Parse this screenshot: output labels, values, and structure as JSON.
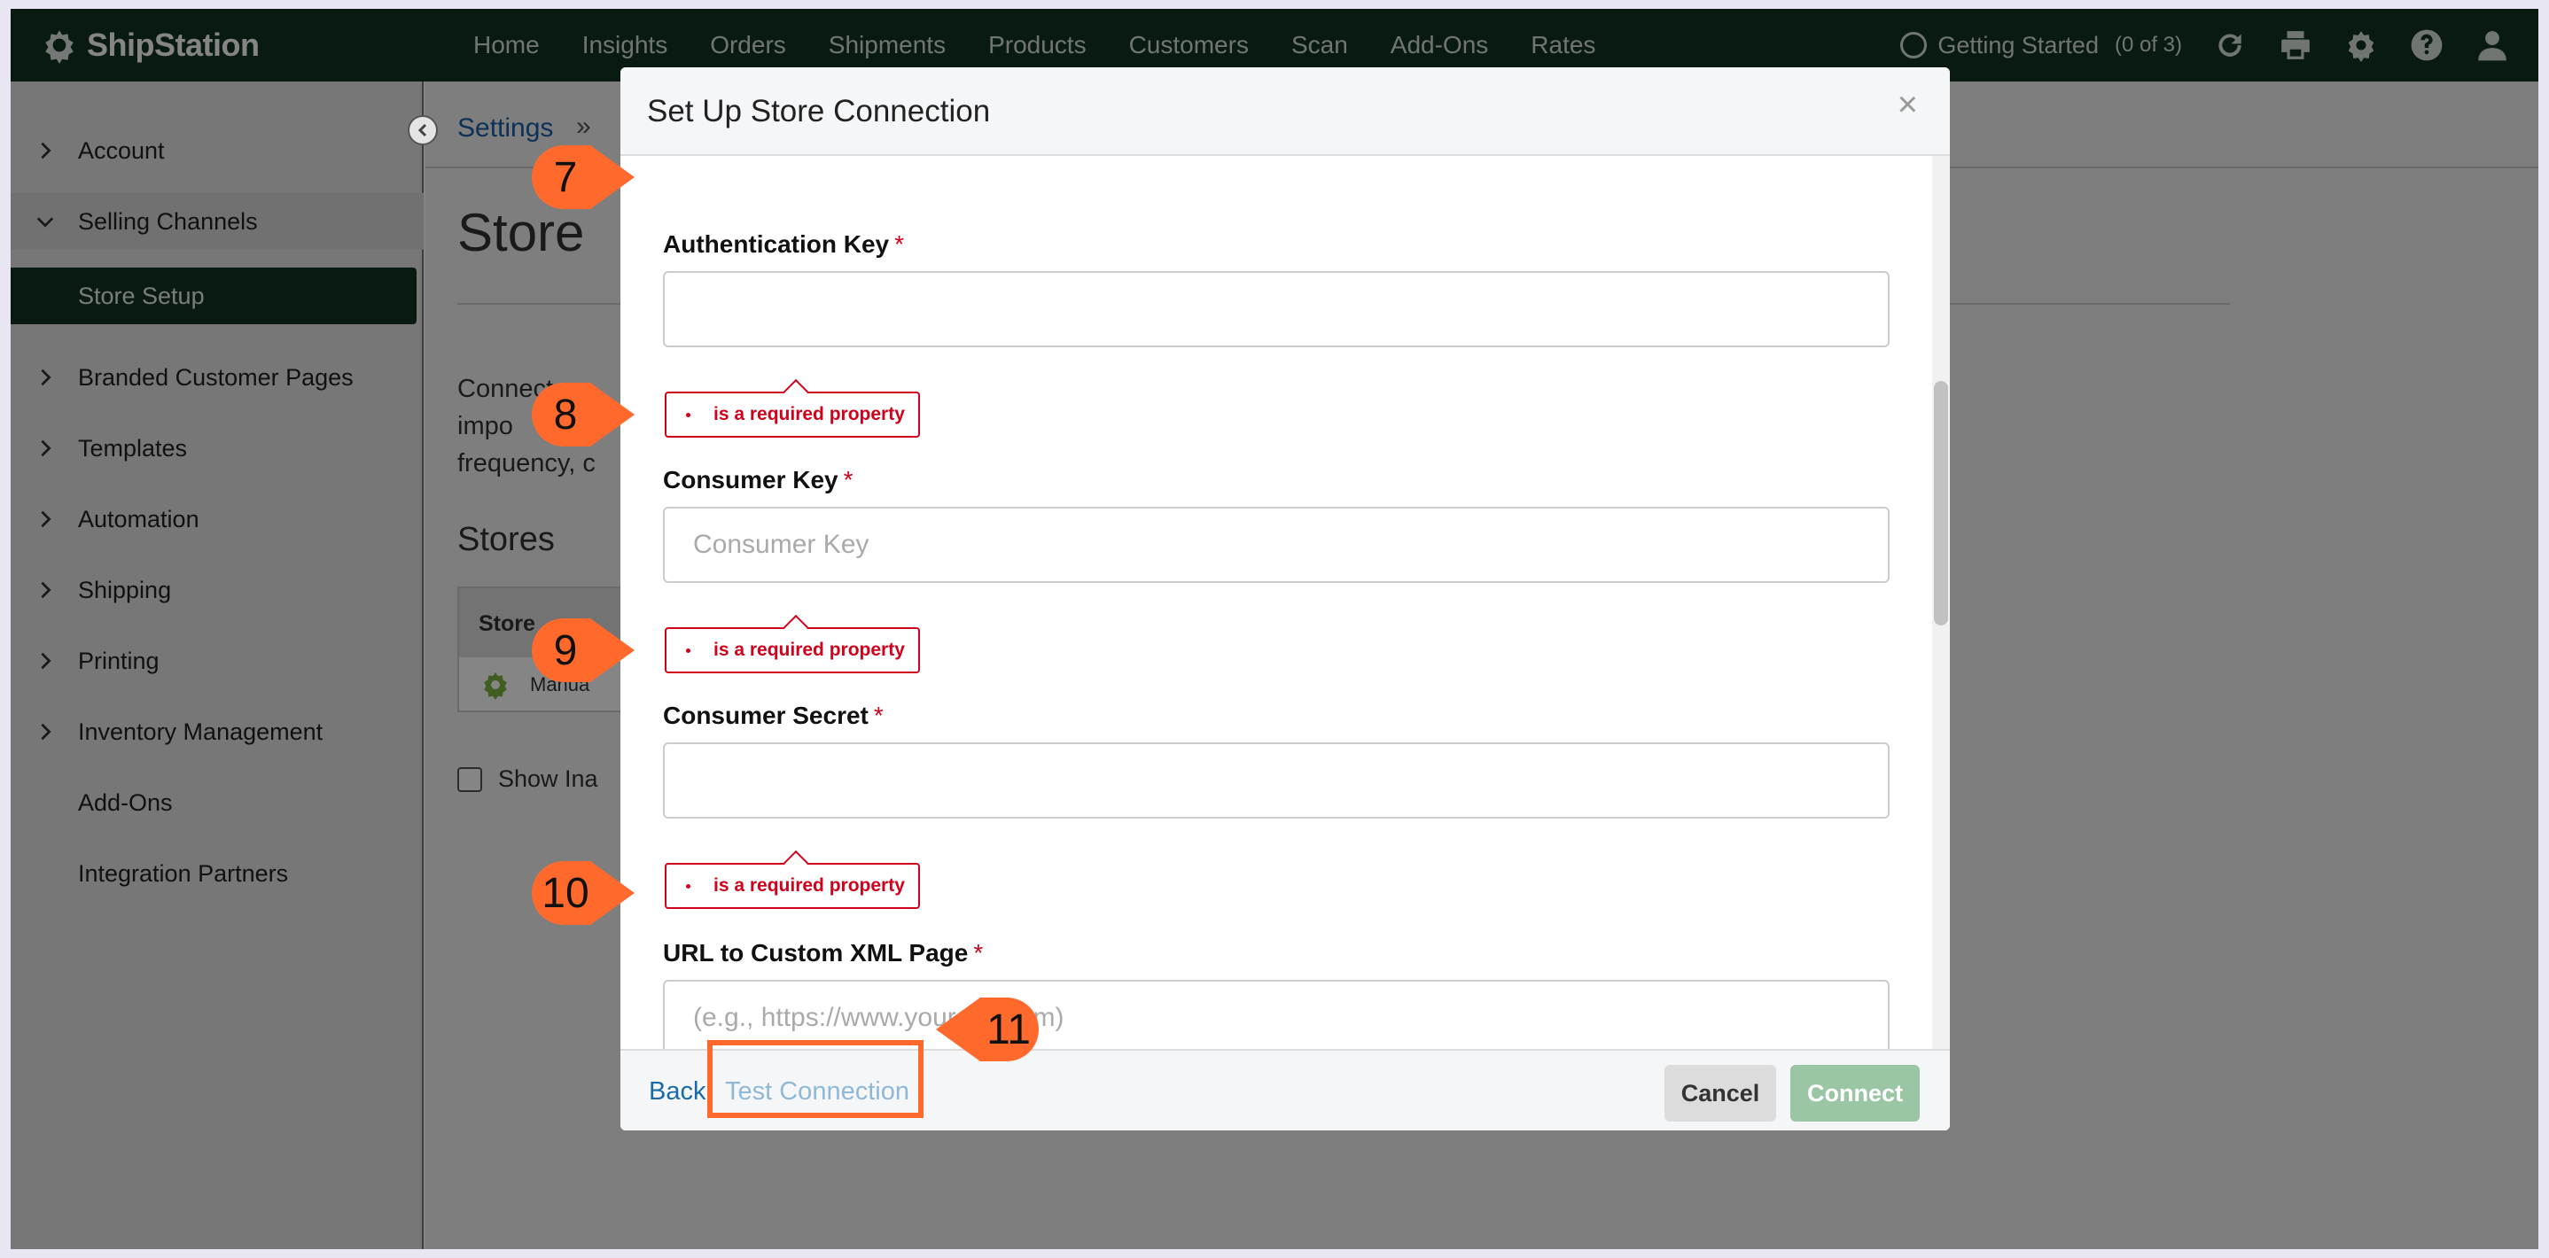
{
  "app": {
    "brand": "ShipStation",
    "nav": [
      "Home",
      "Insights",
      "Orders",
      "Shipments",
      "Products",
      "Customers",
      "Scan",
      "Add-Ons",
      "Rates"
    ],
    "getting_started": "Getting Started",
    "getting_started_count": "(0 of 3)"
  },
  "sidebar": {
    "items": [
      {
        "label": "Account"
      },
      {
        "label": "Selling Channels"
      },
      {
        "label": "Store Setup"
      },
      {
        "label": "Branded Customer Pages"
      },
      {
        "label": "Templates"
      },
      {
        "label": "Automation"
      },
      {
        "label": "Shipping"
      },
      {
        "label": "Printing"
      },
      {
        "label": "Inventory Management"
      },
      {
        "label": "Add-Ons"
      },
      {
        "label": "Integration Partners"
      }
    ]
  },
  "page": {
    "breadcrumb": "Settings",
    "breadcrumb_sep": "»",
    "title": "Store",
    "description": "Connect an\nimpo\nfrequency, c",
    "stores_heading": "Stores",
    "stores_table_header": "Store",
    "stores_row_text": "Manua",
    "show_inactive": "Show Ina"
  },
  "modal": {
    "title": "Set Up Store Connection",
    "close": "×",
    "fields": [
      {
        "label": "Authentication Key",
        "placeholder": "",
        "value": ""
      },
      {
        "label": "Consumer Key",
        "placeholder": "Consumer Key",
        "value": ""
      },
      {
        "label": "Consumer Secret",
        "placeholder": "",
        "value": ""
      },
      {
        "label": "URL to Custom XML Page",
        "placeholder": "(e.g., https://www.yoursite.com)",
        "value": ""
      }
    ],
    "required_mark": "*",
    "error_text": "is a required property",
    "footer": {
      "back": "Back",
      "test_connection": "Test Connection",
      "cancel": "Cancel",
      "connect": "Connect"
    }
  },
  "callouts": [
    "7",
    "8",
    "9",
    "10",
    "11"
  ],
  "colors": {
    "nav_bg": "#123522",
    "accent_callout": "#ff6a2c",
    "error": "#d0021b",
    "connect_button": "#9bc6a6"
  }
}
